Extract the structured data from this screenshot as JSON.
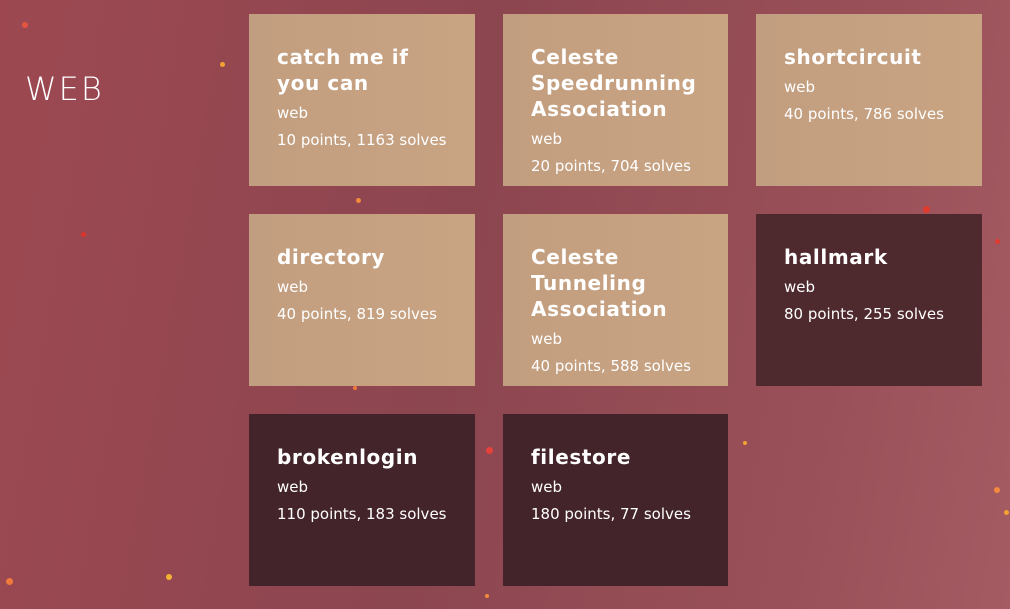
{
  "section": {
    "title": "WEB"
  },
  "challenges": [
    {
      "title": "catch me if you can",
      "category": "web",
      "points": "10 points, 1163 solves",
      "solved": false
    },
    {
      "title": "Celeste Speedrunning Association",
      "category": "web",
      "points": "20 points, 704 solves",
      "solved": false
    },
    {
      "title": "shortcircuit",
      "category": "web",
      "points": "40 points, 786 solves",
      "solved": false
    },
    {
      "title": "directory",
      "category": "web",
      "points": "40 points, 819 solves",
      "solved": false
    },
    {
      "title": "Celeste Tunneling Association",
      "category": "web",
      "points": "40 points, 588 solves",
      "solved": false
    },
    {
      "title": "hallmark",
      "category": "web",
      "points": "80 points, 255 solves",
      "solved": true
    },
    {
      "title": "brokenlogin",
      "category": "web",
      "points": "110 points, 183 solves",
      "solved": true
    },
    {
      "title": "filestore",
      "category": "web",
      "points": "180 points, 77 solves",
      "solved": true
    }
  ],
  "colors": {
    "background": "#9d4851",
    "unsolved_card": "#c6a282",
    "solved_card": "#4e2a2f",
    "text": "#ffffff"
  }
}
